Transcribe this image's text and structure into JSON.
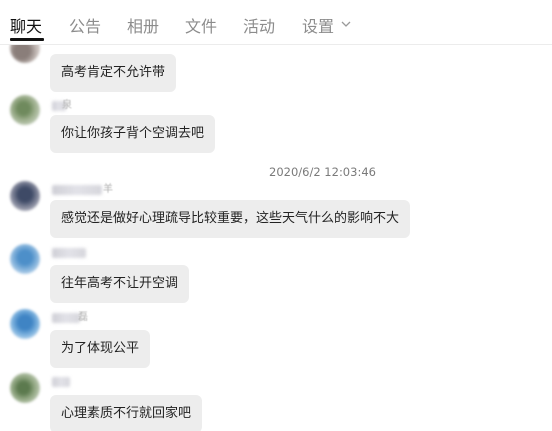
{
  "tabs": {
    "chat": "聊天",
    "announcement": "公告",
    "album": "相册",
    "files": "文件",
    "activity": "活动",
    "settings": "设置"
  },
  "chat": {
    "timestamp": "2020/6/2 12:03:46",
    "messages": [
      {
        "text": "高考肯定不允许带"
      },
      {
        "nick_fragment": "泉",
        "text": "你让你孩子背个空调去吧"
      },
      {
        "nick_fragment": "羊",
        "text": "感觉还是做好心理疏导比较重要，这些天气什么的影响不大"
      },
      {
        "text": "往年高考不让开空调"
      },
      {
        "nick_fragment": "磊",
        "text": "为了体现公平"
      },
      {
        "text": "心理素质不行就回家吧"
      }
    ]
  },
  "colors": {
    "bubble_bg": "#ededed",
    "tab_active": "#111111",
    "tab_inactive": "#8c8c8c"
  },
  "icons": [
    "chevron-down-icon"
  ]
}
